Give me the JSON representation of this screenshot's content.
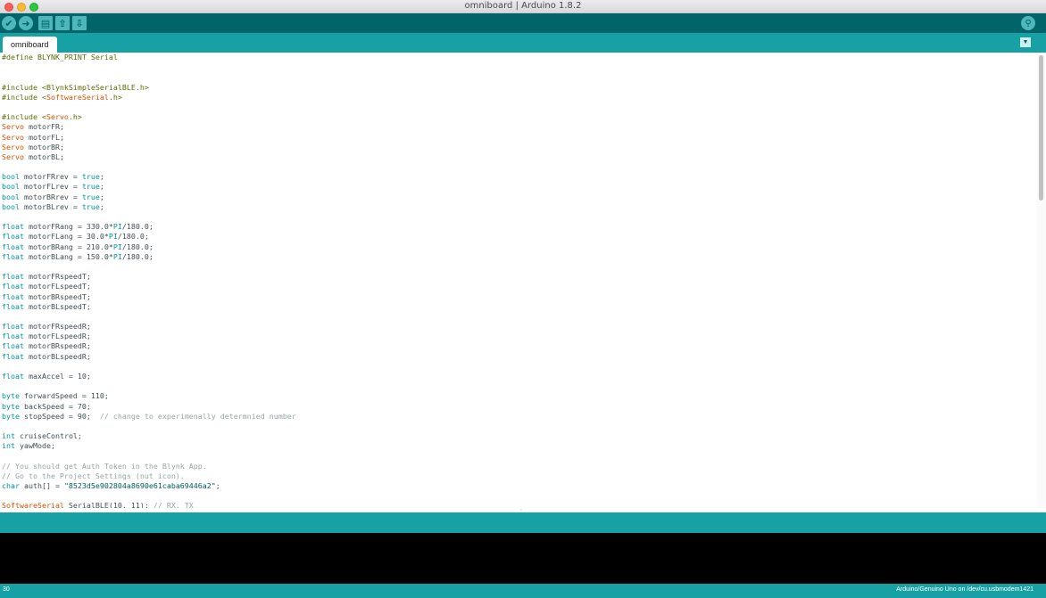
{
  "window": {
    "title": "omniboard | Arduino 1.8.2"
  },
  "toolbar": {
    "verify_glyph": "✔",
    "upload_glyph": "➜",
    "new_glyph": "▤",
    "open_glyph": "⇧",
    "save_glyph": "⇩",
    "serial_glyph": "⚲"
  },
  "tabs": {
    "active": "omniboard",
    "menu_glyph": "▼"
  },
  "editor": {
    "lines": [
      [
        [
          "pp",
          "#define BLYNK_PRINT Serial"
        ]
      ],
      [],
      [],
      [
        [
          "pp",
          "#include <BlynkSimpleSerialBLE.h>"
        ]
      ],
      [
        [
          "pp",
          "#include <"
        ],
        [
          "cls",
          "SoftwareSerial"
        ],
        [
          "pp",
          ".h>"
        ]
      ],
      [],
      [
        [
          "pp",
          "#include <"
        ],
        [
          "cls",
          "Servo"
        ],
        [
          "pp",
          ".h>"
        ]
      ],
      [
        [
          "cls",
          "Servo"
        ],
        [
          "txt",
          " motorFR;"
        ]
      ],
      [
        [
          "cls",
          "Servo"
        ],
        [
          "txt",
          " motorFL;"
        ]
      ],
      [
        [
          "cls",
          "Servo"
        ],
        [
          "txt",
          " motorBR;"
        ]
      ],
      [
        [
          "cls",
          "Servo"
        ],
        [
          "txt",
          " motorBL;"
        ]
      ],
      [],
      [
        [
          "type",
          "bool"
        ],
        [
          "txt",
          " motorFRrev = "
        ],
        [
          "lit",
          "true"
        ],
        [
          "txt",
          ";"
        ]
      ],
      [
        [
          "type",
          "bool"
        ],
        [
          "txt",
          " motorFLrev = "
        ],
        [
          "lit",
          "true"
        ],
        [
          "txt",
          ";"
        ]
      ],
      [
        [
          "type",
          "bool"
        ],
        [
          "txt",
          " motorBRrev = "
        ],
        [
          "lit",
          "true"
        ],
        [
          "txt",
          ";"
        ]
      ],
      [
        [
          "type",
          "bool"
        ],
        [
          "txt",
          " motorBLrev = "
        ],
        [
          "lit",
          "true"
        ],
        [
          "txt",
          ";"
        ]
      ],
      [],
      [
        [
          "type",
          "float"
        ],
        [
          "txt",
          " motorFRang = 330.0*"
        ],
        [
          "lit",
          "PI"
        ],
        [
          "txt",
          "/180.0;"
        ]
      ],
      [
        [
          "type",
          "float"
        ],
        [
          "txt",
          " motorFLang = 30.0*"
        ],
        [
          "lit",
          "PI"
        ],
        [
          "txt",
          "/180.0;"
        ]
      ],
      [
        [
          "type",
          "float"
        ],
        [
          "txt",
          " motorBRang = 210.0*"
        ],
        [
          "lit",
          "PI"
        ],
        [
          "txt",
          "/180.0;"
        ]
      ],
      [
        [
          "type",
          "float"
        ],
        [
          "txt",
          " motorBLang = 150.0*"
        ],
        [
          "lit",
          "PI"
        ],
        [
          "txt",
          "/180.0;"
        ]
      ],
      [],
      [
        [
          "type",
          "float"
        ],
        [
          "txt",
          " motorFRspeedT;"
        ]
      ],
      [
        [
          "type",
          "float"
        ],
        [
          "txt",
          " motorFLspeedT;"
        ]
      ],
      [
        [
          "type",
          "float"
        ],
        [
          "txt",
          " motorBRspeedT;"
        ]
      ],
      [
        [
          "type",
          "float"
        ],
        [
          "txt",
          " motorBLspeedT;"
        ]
      ],
      [],
      [
        [
          "type",
          "float"
        ],
        [
          "txt",
          " motorFRspeedR;"
        ]
      ],
      [
        [
          "type",
          "float"
        ],
        [
          "txt",
          " motorFLspeedR;"
        ]
      ],
      [
        [
          "type",
          "float"
        ],
        [
          "txt",
          " motorBRspeedR;"
        ]
      ],
      [
        [
          "type",
          "float"
        ],
        [
          "txt",
          " motorBLspeedR;"
        ]
      ],
      [],
      [
        [
          "type",
          "float"
        ],
        [
          "txt",
          " maxAccel = 10;"
        ]
      ],
      [],
      [
        [
          "type",
          "byte"
        ],
        [
          "txt",
          " forwardSpeed = 110;"
        ]
      ],
      [
        [
          "type",
          "byte"
        ],
        [
          "txt",
          " backSpeed = 70;"
        ]
      ],
      [
        [
          "type",
          "byte"
        ],
        [
          "txt",
          " stopSpeed = 90;  "
        ],
        [
          "cmt",
          "// change to experimenally determnied number"
        ]
      ],
      [],
      [
        [
          "type",
          "int"
        ],
        [
          "txt",
          " cruiseControl;"
        ]
      ],
      [
        [
          "type",
          "int"
        ],
        [
          "txt",
          " yawMode;"
        ]
      ],
      [],
      [
        [
          "cmt",
          "// You should get Auth Token in the Blynk App."
        ]
      ],
      [
        [
          "cmt",
          "// Go to the Project Settings (nut icon)."
        ]
      ],
      [
        [
          "type",
          "char"
        ],
        [
          "txt",
          " auth[] = "
        ],
        [
          "str",
          "\"8523d5e902804a8690e61caba69446a2\""
        ],
        [
          "txt",
          ";"
        ]
      ],
      [],
      [
        [
          "cls",
          "SoftwareSerial"
        ],
        [
          "txt",
          " SerialBLE(10, 11); "
        ],
        [
          "cmt",
          "// RX, TX"
        ]
      ]
    ]
  },
  "status": {
    "line_number": "30",
    "board": "Arduino/Genuino Uno on /dev/cu.usbmodem1421"
  }
}
